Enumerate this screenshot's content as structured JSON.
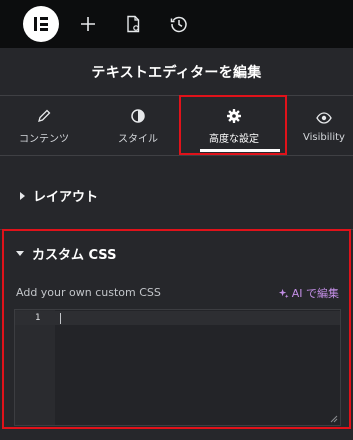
{
  "topbar": {
    "logo_icon": "elementor-logo-icon",
    "add_icon": "plus-icon",
    "page_settings_icon": "page-settings-icon",
    "history_icon": "history-icon"
  },
  "header": {
    "title": "テキストエディターを編集"
  },
  "tabs": [
    {
      "label": "コンテンツ",
      "icon": "pencil-icon"
    },
    {
      "label": "スタイル",
      "icon": "contrast-icon"
    },
    {
      "label": "高度な設定",
      "icon": "gear-icon",
      "active": true
    },
    {
      "label": "Visibility",
      "icon": "eye-icon"
    }
  ],
  "sections": {
    "layout": {
      "title": "レイアウト",
      "state": "collapsed"
    },
    "custom_css": {
      "title": "カスタム CSS",
      "state": "expanded",
      "field_label": "Add your own custom CSS",
      "ai_button": "AI で編集",
      "editor": {
        "line_numbers": [
          "1"
        ],
        "value": ""
      }
    }
  },
  "colors": {
    "topbar_bg": "#0c0d0e",
    "panel_bg": "#26272b",
    "highlight": "#e0121a",
    "ai_accent": "#c38ee6"
  }
}
